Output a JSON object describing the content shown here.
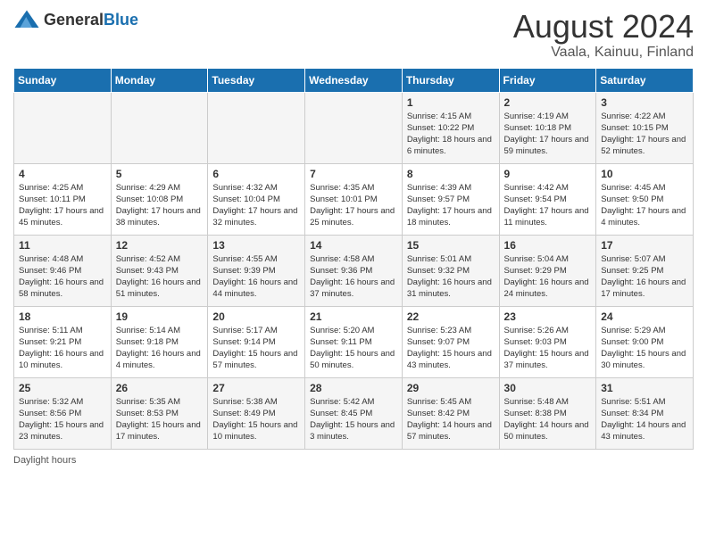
{
  "header": {
    "logo_general": "General",
    "logo_blue": "Blue",
    "main_title": "August 2024",
    "subtitle": "Vaala, Kainuu, Finland"
  },
  "calendar": {
    "days_of_week": [
      "Sunday",
      "Monday",
      "Tuesday",
      "Wednesday",
      "Thursday",
      "Friday",
      "Saturday"
    ],
    "weeks": [
      [
        {
          "day": "",
          "content": ""
        },
        {
          "day": "",
          "content": ""
        },
        {
          "day": "",
          "content": ""
        },
        {
          "day": "",
          "content": ""
        },
        {
          "day": "1",
          "content": "Sunrise: 4:15 AM\nSunset: 10:22 PM\nDaylight: 18 hours and 6 minutes."
        },
        {
          "day": "2",
          "content": "Sunrise: 4:19 AM\nSunset: 10:18 PM\nDaylight: 17 hours and 59 minutes."
        },
        {
          "day": "3",
          "content": "Sunrise: 4:22 AM\nSunset: 10:15 PM\nDaylight: 17 hours and 52 minutes."
        }
      ],
      [
        {
          "day": "4",
          "content": "Sunrise: 4:25 AM\nSunset: 10:11 PM\nDaylight: 17 hours and 45 minutes."
        },
        {
          "day": "5",
          "content": "Sunrise: 4:29 AM\nSunset: 10:08 PM\nDaylight: 17 hours and 38 minutes."
        },
        {
          "day": "6",
          "content": "Sunrise: 4:32 AM\nSunset: 10:04 PM\nDaylight: 17 hours and 32 minutes."
        },
        {
          "day": "7",
          "content": "Sunrise: 4:35 AM\nSunset: 10:01 PM\nDaylight: 17 hours and 25 minutes."
        },
        {
          "day": "8",
          "content": "Sunrise: 4:39 AM\nSunset: 9:57 PM\nDaylight: 17 hours and 18 minutes."
        },
        {
          "day": "9",
          "content": "Sunrise: 4:42 AM\nSunset: 9:54 PM\nDaylight: 17 hours and 11 minutes."
        },
        {
          "day": "10",
          "content": "Sunrise: 4:45 AM\nSunset: 9:50 PM\nDaylight: 17 hours and 4 minutes."
        }
      ],
      [
        {
          "day": "11",
          "content": "Sunrise: 4:48 AM\nSunset: 9:46 PM\nDaylight: 16 hours and 58 minutes."
        },
        {
          "day": "12",
          "content": "Sunrise: 4:52 AM\nSunset: 9:43 PM\nDaylight: 16 hours and 51 minutes."
        },
        {
          "day": "13",
          "content": "Sunrise: 4:55 AM\nSunset: 9:39 PM\nDaylight: 16 hours and 44 minutes."
        },
        {
          "day": "14",
          "content": "Sunrise: 4:58 AM\nSunset: 9:36 PM\nDaylight: 16 hours and 37 minutes."
        },
        {
          "day": "15",
          "content": "Sunrise: 5:01 AM\nSunset: 9:32 PM\nDaylight: 16 hours and 31 minutes."
        },
        {
          "day": "16",
          "content": "Sunrise: 5:04 AM\nSunset: 9:29 PM\nDaylight: 16 hours and 24 minutes."
        },
        {
          "day": "17",
          "content": "Sunrise: 5:07 AM\nSunset: 9:25 PM\nDaylight: 16 hours and 17 minutes."
        }
      ],
      [
        {
          "day": "18",
          "content": "Sunrise: 5:11 AM\nSunset: 9:21 PM\nDaylight: 16 hours and 10 minutes."
        },
        {
          "day": "19",
          "content": "Sunrise: 5:14 AM\nSunset: 9:18 PM\nDaylight: 16 hours and 4 minutes."
        },
        {
          "day": "20",
          "content": "Sunrise: 5:17 AM\nSunset: 9:14 PM\nDaylight: 15 hours and 57 minutes."
        },
        {
          "day": "21",
          "content": "Sunrise: 5:20 AM\nSunset: 9:11 PM\nDaylight: 15 hours and 50 minutes."
        },
        {
          "day": "22",
          "content": "Sunrise: 5:23 AM\nSunset: 9:07 PM\nDaylight: 15 hours and 43 minutes."
        },
        {
          "day": "23",
          "content": "Sunrise: 5:26 AM\nSunset: 9:03 PM\nDaylight: 15 hours and 37 minutes."
        },
        {
          "day": "24",
          "content": "Sunrise: 5:29 AM\nSunset: 9:00 PM\nDaylight: 15 hours and 30 minutes."
        }
      ],
      [
        {
          "day": "25",
          "content": "Sunrise: 5:32 AM\nSunset: 8:56 PM\nDaylight: 15 hours and 23 minutes."
        },
        {
          "day": "26",
          "content": "Sunrise: 5:35 AM\nSunset: 8:53 PM\nDaylight: 15 hours and 17 minutes."
        },
        {
          "day": "27",
          "content": "Sunrise: 5:38 AM\nSunset: 8:49 PM\nDaylight: 15 hours and 10 minutes."
        },
        {
          "day": "28",
          "content": "Sunrise: 5:42 AM\nSunset: 8:45 PM\nDaylight: 15 hours and 3 minutes."
        },
        {
          "day": "29",
          "content": "Sunrise: 5:45 AM\nSunset: 8:42 PM\nDaylight: 14 hours and 57 minutes."
        },
        {
          "day": "30",
          "content": "Sunrise: 5:48 AM\nSunset: 8:38 PM\nDaylight: 14 hours and 50 minutes."
        },
        {
          "day": "31",
          "content": "Sunrise: 5:51 AM\nSunset: 8:34 PM\nDaylight: 14 hours and 43 minutes."
        }
      ]
    ]
  },
  "footer": {
    "note": "Daylight hours"
  }
}
